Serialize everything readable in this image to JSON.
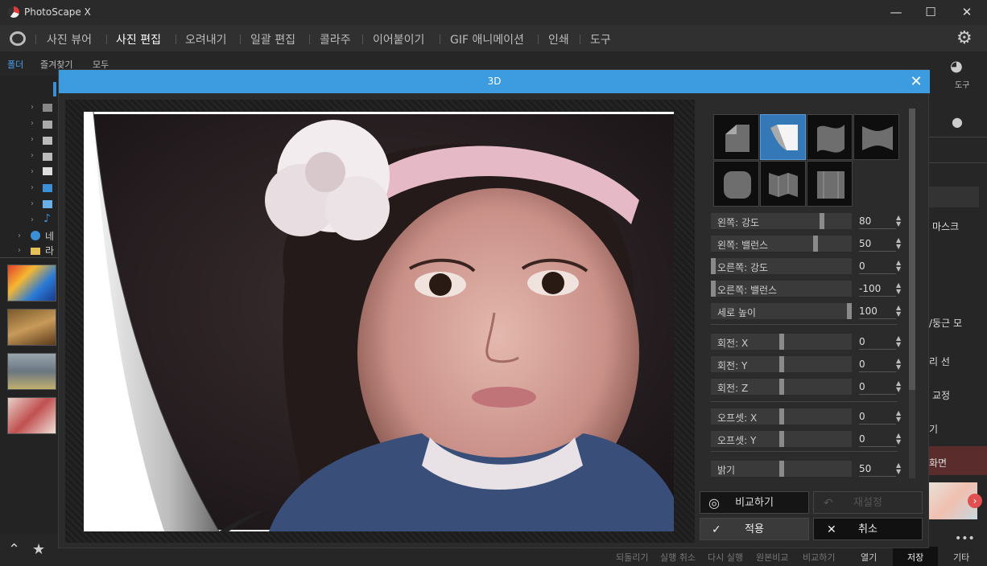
{
  "app": {
    "title": "PhotoScape X",
    "min": "—",
    "max": "☐",
    "close": "✕"
  },
  "nav": {
    "items": [
      "사진 뷰어",
      "사진 편집",
      "오려내기",
      "일괄 편집",
      "콜라주",
      "이어붙이기",
      "GIF 애니메이션",
      "인쇄",
      "도구"
    ],
    "active": "사진 편집"
  },
  "side_tabs": [
    "폴더",
    "즐겨찾기",
    "모두"
  ],
  "tree_labels": [
    "네",
    "라"
  ],
  "right_panel": {
    "tools_label": "도구",
    "items": [
      "마스크",
      "/둥근 모",
      "리 선",
      "교정",
      "기",
      "화면"
    ]
  },
  "dialog": {
    "title": "3D",
    "sliders": [
      {
        "label": "왼쪽: 강도",
        "value": "80",
        "level": 0.8
      },
      {
        "label": "왼쪽: 밸런스",
        "value": "50",
        "level": 0.75
      },
      {
        "label": "오른쪽: 강도",
        "value": "0",
        "level": 0.0
      },
      {
        "label": "오른쪽: 밸런스",
        "value": "-100",
        "level": 0.0
      },
      {
        "label": "세로 높이",
        "value": "100",
        "level": 1.0
      },
      {
        "label": "회전: X",
        "value": "0",
        "level": 0.5
      },
      {
        "label": "회전: Y",
        "value": "0",
        "level": 0.5
      },
      {
        "label": "회전: Z",
        "value": "0",
        "level": 0.5
      },
      {
        "label": "오프셋: X",
        "value": "0",
        "level": 0.5
      },
      {
        "label": "오프셋: Y",
        "value": "0",
        "level": 0.5
      },
      {
        "label": "밝기",
        "value": "50",
        "level": 0.5
      }
    ],
    "buttons": {
      "compare": "비교하기",
      "reset": "재설정",
      "apply": "적용",
      "cancel": "취소"
    }
  },
  "bottom": {
    "labels": [
      "되돌리기",
      "실행 취소",
      "다시 실행",
      "원본비교",
      "비교하기"
    ],
    "open": "열기",
    "save": "저장",
    "more": "기타"
  }
}
